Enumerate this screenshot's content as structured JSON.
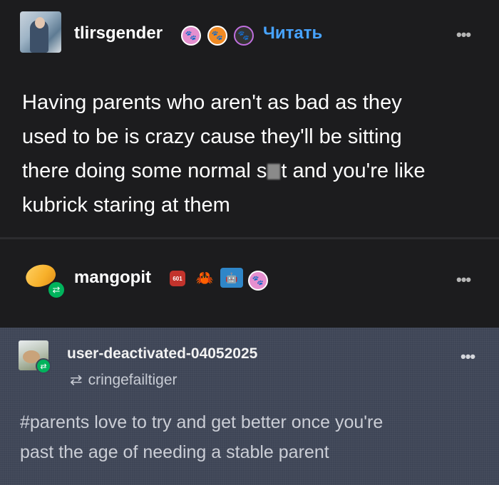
{
  "post1": {
    "username": "tlirsgender",
    "follow_label": "Читать",
    "menu_glyph": "•••",
    "body": [
      "Having parents who aren't as bad as they",
      "used to be is crazy cause they'll be sitting",
      "there doing some normal s",
      "t and you're like",
      "kubrick staring at them"
    ],
    "badges": [
      "paw-badge-pink",
      "paw-badge-orange",
      "paw-badge-dark"
    ]
  },
  "post2": {
    "username": "mangopit",
    "menu_glyph": "•••",
    "badges": [
      "badge-red-hex",
      "crab-badge",
      "robot-badge",
      "paw-badge-pink"
    ]
  },
  "post3": {
    "username": "user-deactivated-04052025",
    "reblogged_from": "cringefailtiger",
    "menu_glyph": "•••",
    "tags": [
      "#parents love to try and get better once you're",
      "past the age of needing a stable parent"
    ]
  },
  "colors": {
    "accent": "#47a3ff",
    "reblog_green": "#00b35c",
    "panel": "#1c1c1e",
    "tag_panel": "#3e4556"
  }
}
